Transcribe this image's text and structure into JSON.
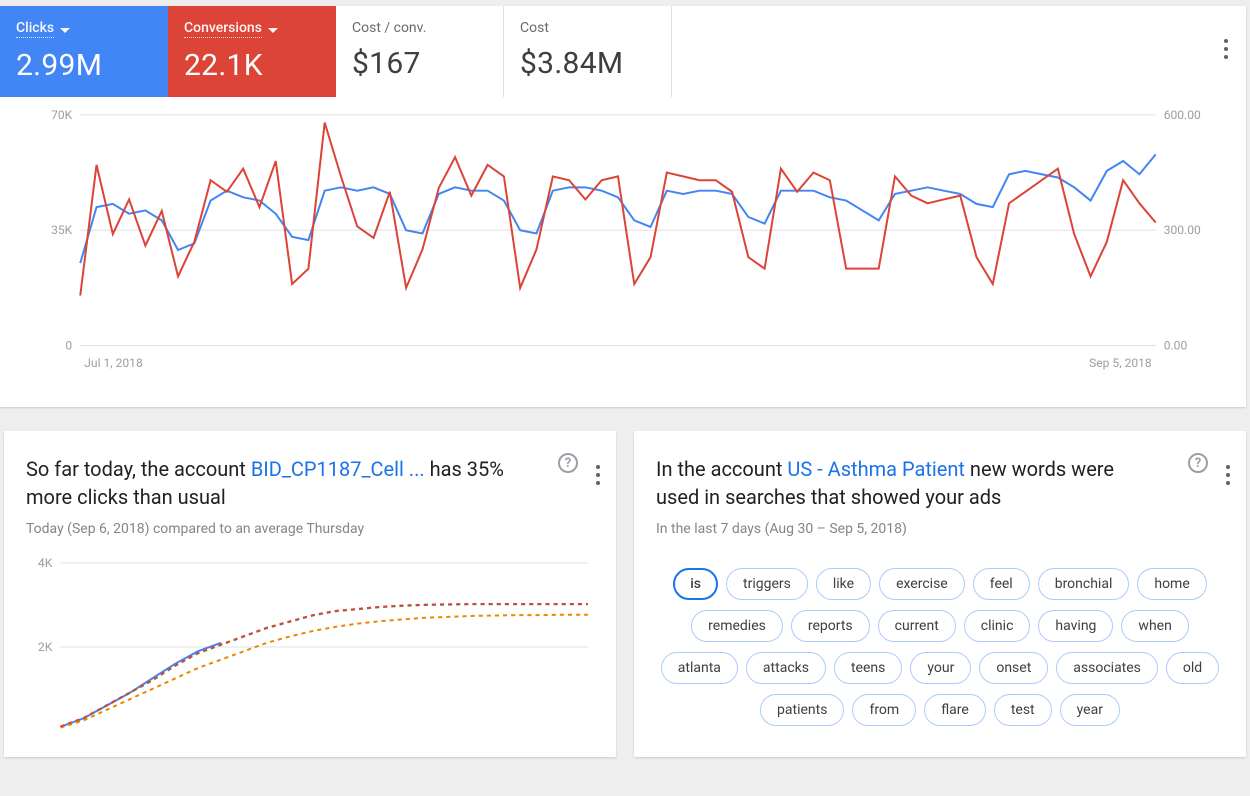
{
  "metrics": {
    "clicks": {
      "label": "Clicks",
      "value": "2.99M",
      "dropdown": true
    },
    "conversions": {
      "label": "Conversions",
      "value": "22.1K",
      "dropdown": true
    },
    "cpc": {
      "label": "Cost / conv.",
      "value": "$167"
    },
    "cost": {
      "label": "Cost",
      "value": "$3.84M"
    }
  },
  "chart_data": {
    "type": "line",
    "x_start_label": "Jul 1, 2018",
    "x_end_label": "Sep 5, 2018",
    "y_left": {
      "ticks": [
        "0",
        "35K",
        "70K"
      ],
      "min": 0,
      "max": 70000
    },
    "y_right": {
      "ticks": [
        "0.00",
        "300.00",
        "600.00"
      ],
      "min": 0,
      "max": 600
    },
    "series": [
      {
        "name": "Clicks",
        "axis": "left",
        "color": "#4285f4",
        "values": [
          25000,
          42000,
          43000,
          40000,
          41000,
          38000,
          29000,
          31000,
          44000,
          47000,
          45000,
          44000,
          40000,
          33000,
          32000,
          47000,
          48000,
          47000,
          48000,
          46000,
          35000,
          34000,
          46000,
          48000,
          47000,
          47000,
          44000,
          35000,
          34000,
          47000,
          48000,
          48000,
          47000,
          45000,
          38000,
          36000,
          47000,
          46000,
          47000,
          47000,
          46000,
          39000,
          37000,
          47000,
          47000,
          47000,
          45000,
          44000,
          41000,
          38000,
          46000,
          47000,
          48000,
          47000,
          46000,
          43000,
          42000,
          52000,
          53000,
          52000,
          51000,
          48000,
          44000,
          53000,
          56000,
          52000,
          58000
        ]
      },
      {
        "name": "Conversions",
        "axis": "right",
        "color": "#db4437",
        "values": [
          130,
          470,
          290,
          380,
          260,
          350,
          180,
          270,
          430,
          400,
          460,
          360,
          480,
          160,
          200,
          580,
          440,
          310,
          280,
          400,
          150,
          250,
          410,
          490,
          390,
          470,
          440,
          150,
          250,
          440,
          430,
          380,
          430,
          440,
          160,
          230,
          450,
          440,
          430,
          430,
          400,
          230,
          200,
          460,
          400,
          450,
          430,
          200,
          200,
          200,
          440,
          390,
          370,
          380,
          390,
          230,
          160,
          370,
          400,
          430,
          460,
          290,
          180,
          270,
          430,
          370,
          320
        ]
      }
    ]
  },
  "insight_left": {
    "prefix": "So far today, the account ",
    "link": "BID_CP1187_Cell ...",
    "suffix": " has 35% more clicks than usual",
    "subtitle": "Today (Sep 6, 2018) compared to an average Thursday",
    "mini_chart": {
      "type": "line",
      "y_ticks": [
        "2K",
        "4K"
      ],
      "ymax": 4000,
      "series": [
        {
          "name": "today",
          "style": "solid",
          "color": "#4285f4",
          "values": [
            100,
            300,
            600,
            900,
            1250,
            1600,
            1900,
            2100
          ]
        },
        {
          "name": "avg_a",
          "style": "dashed",
          "color": "#34a853",
          "values": [
            100,
            300,
            600,
            900,
            1200,
            1550,
            1850,
            2050,
            2250,
            2450,
            2600,
            2750,
            2850,
            2900,
            2950,
            2980,
            3000,
            3010,
            3020,
            3020,
            3020,
            3020,
            3020,
            3020
          ]
        },
        {
          "name": "avg_b",
          "style": "dashed",
          "color": "#ea8600",
          "values": [
            80,
            250,
            500,
            750,
            1000,
            1250,
            1500,
            1700,
            1900,
            2100,
            2250,
            2380,
            2480,
            2560,
            2620,
            2660,
            2700,
            2720,
            2740,
            2750,
            2760,
            2760,
            2770,
            2770
          ]
        },
        {
          "name": "avg_c",
          "style": "dashed",
          "color": "#db4437",
          "values": [
            110,
            310,
            610,
            910,
            1210,
            1560,
            1860,
            2060,
            2260,
            2460,
            2610,
            2760,
            2860,
            2910,
            2960,
            2990,
            3010,
            3020,
            3025,
            3025,
            3025,
            3025,
            3025,
            3025
          ]
        }
      ]
    }
  },
  "insight_right": {
    "prefix": "In the account ",
    "link": "US - Asthma Patient",
    "suffix": " new words were used in searches that showed your ads",
    "subtitle": "In the last 7 days (Aug 30 – Sep 5, 2018)",
    "pills": [
      "is",
      "triggers",
      "like",
      "exercise",
      "feel",
      "bronchial",
      "home",
      "remedies",
      "reports",
      "current",
      "clinic",
      "having",
      "when",
      "atlanta",
      "attacks",
      "teens",
      "your",
      "onset",
      "associates",
      "old",
      "patients",
      "from",
      "flare",
      "test",
      "year"
    ],
    "active_pill_index": 0
  }
}
